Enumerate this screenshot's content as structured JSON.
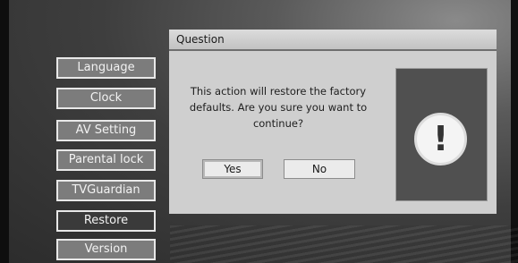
{
  "menu": {
    "items": [
      {
        "label": "Language",
        "active": false
      },
      {
        "label": "Clock",
        "active": false
      },
      {
        "label": "AV Setting",
        "active": false
      },
      {
        "label": "Parental lock",
        "active": false
      },
      {
        "label": "TVGuardian",
        "active": false
      },
      {
        "label": "Restore",
        "active": true
      },
      {
        "label": "Version",
        "active": false
      }
    ]
  },
  "dialog": {
    "title": "Question",
    "message_lines": [
      "This action will restore the factory",
      "defaults. Are you sure you want to",
      "continue?"
    ],
    "yes_label": "Yes",
    "no_label": "No",
    "icon": "exclamation-icon",
    "icon_glyph": "!"
  },
  "colors": {
    "dialog_bg": "#cfcfcf",
    "menu_item_bg": "#7c7c7c",
    "menu_item_active_bg": "#3a3a3a",
    "icon_panel_bg": "#505050"
  }
}
